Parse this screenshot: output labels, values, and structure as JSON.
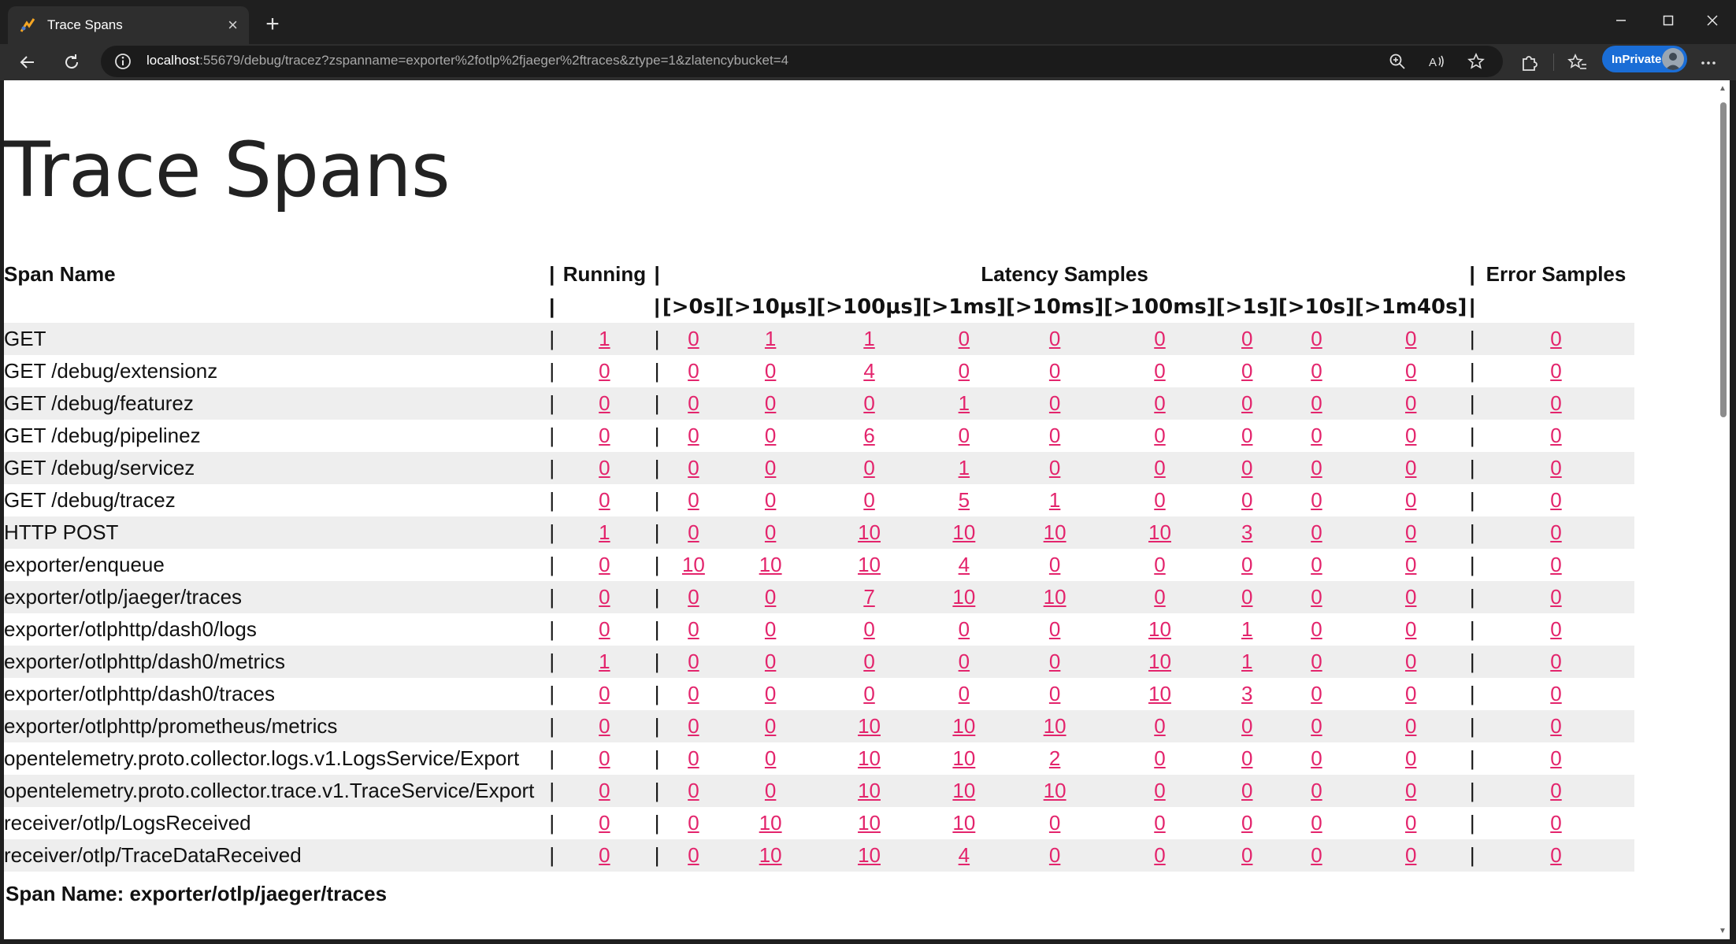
{
  "browser": {
    "tab_title": "Trace Spans",
    "url_host": "localhost",
    "url_rest": ":55679/debug/tracez?zspanname=exporter%2fotlp%2fjaeger%2ftraces&ztype=1&zlatencybucket=4",
    "inprivate_label": "InPrivate",
    "accent": "#1a6dd6"
  },
  "page": {
    "title": "Trace Spans",
    "selected_span_label": "Span Name: exporter/otlp/jaeger/traces",
    "link_color": "#e3246c",
    "row_shade": "#eeeeee"
  },
  "table": {
    "header": {
      "span_name": "Span Name",
      "running": "Running",
      "latency_samples": "Latency Samples",
      "error_samples": "Error Samples",
      "separator": "|"
    },
    "latency_buckets": [
      "[>0s]",
      "[>10μs]",
      "[>100μs]",
      "[>1ms]",
      "[>10ms]",
      "[>100ms]",
      "[>1s]",
      "[>10s]",
      "[>1m40s]"
    ],
    "rows": [
      {
        "name": "GET",
        "running": "1",
        "latency": [
          "0",
          "1",
          "1",
          "0",
          "0",
          "0",
          "0",
          "0",
          "0"
        ],
        "errors": "0"
      },
      {
        "name": "GET /debug/extensionz",
        "running": "0",
        "latency": [
          "0",
          "0",
          "4",
          "0",
          "0",
          "0",
          "0",
          "0",
          "0"
        ],
        "errors": "0"
      },
      {
        "name": "GET /debug/featurez",
        "running": "0",
        "latency": [
          "0",
          "0",
          "0",
          "1",
          "0",
          "0",
          "0",
          "0",
          "0"
        ],
        "errors": "0"
      },
      {
        "name": "GET /debug/pipelinez",
        "running": "0",
        "latency": [
          "0",
          "0",
          "6",
          "0",
          "0",
          "0",
          "0",
          "0",
          "0"
        ],
        "errors": "0"
      },
      {
        "name": "GET /debug/servicez",
        "running": "0",
        "latency": [
          "0",
          "0",
          "0",
          "1",
          "0",
          "0",
          "0",
          "0",
          "0"
        ],
        "errors": "0"
      },
      {
        "name": "GET /debug/tracez",
        "running": "0",
        "latency": [
          "0",
          "0",
          "0",
          "5",
          "1",
          "0",
          "0",
          "0",
          "0"
        ],
        "errors": "0"
      },
      {
        "name": "HTTP POST",
        "running": "1",
        "latency": [
          "0",
          "0",
          "10",
          "10",
          "10",
          "10",
          "3",
          "0",
          "0"
        ],
        "errors": "0"
      },
      {
        "name": "exporter/enqueue",
        "running": "0",
        "latency": [
          "10",
          "10",
          "10",
          "4",
          "0",
          "0",
          "0",
          "0",
          "0"
        ],
        "errors": "0"
      },
      {
        "name": "exporter/otlp/jaeger/traces",
        "running": "0",
        "latency": [
          "0",
          "0",
          "7",
          "10",
          "10",
          "0",
          "0",
          "0",
          "0"
        ],
        "errors": "0"
      },
      {
        "name": "exporter/otlphttp/dash0/logs",
        "running": "0",
        "latency": [
          "0",
          "0",
          "0",
          "0",
          "0",
          "10",
          "1",
          "0",
          "0"
        ],
        "errors": "0"
      },
      {
        "name": "exporter/otlphttp/dash0/metrics",
        "running": "1",
        "latency": [
          "0",
          "0",
          "0",
          "0",
          "0",
          "10",
          "1",
          "0",
          "0"
        ],
        "errors": "0"
      },
      {
        "name": "exporter/otlphttp/dash0/traces",
        "running": "0",
        "latency": [
          "0",
          "0",
          "0",
          "0",
          "0",
          "10",
          "3",
          "0",
          "0"
        ],
        "errors": "0"
      },
      {
        "name": "exporter/otlphttp/prometheus/metrics",
        "running": "0",
        "latency": [
          "0",
          "0",
          "10",
          "10",
          "10",
          "0",
          "0",
          "0",
          "0"
        ],
        "errors": "0"
      },
      {
        "name": "opentelemetry.proto.collector.logs.v1.LogsService/Export",
        "running": "0",
        "latency": [
          "0",
          "0",
          "10",
          "10",
          "2",
          "0",
          "0",
          "0",
          "0"
        ],
        "errors": "0"
      },
      {
        "name": "opentelemetry.proto.collector.trace.v1.TraceService/Export",
        "running": "0",
        "latency": [
          "0",
          "0",
          "10",
          "10",
          "10",
          "0",
          "0",
          "0",
          "0"
        ],
        "errors": "0"
      },
      {
        "name": "receiver/otlp/LogsReceived",
        "running": "0",
        "latency": [
          "0",
          "10",
          "10",
          "10",
          "0",
          "0",
          "0",
          "0",
          "0"
        ],
        "errors": "0"
      },
      {
        "name": "receiver/otlp/TraceDataReceived",
        "running": "0",
        "latency": [
          "0",
          "10",
          "10",
          "4",
          "0",
          "0",
          "0",
          "0",
          "0"
        ],
        "errors": "0"
      }
    ]
  }
}
